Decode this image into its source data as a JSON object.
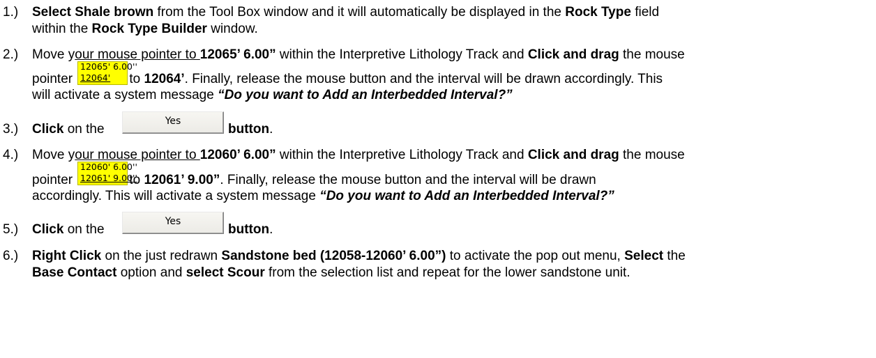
{
  "steps": [
    {
      "num": "1.)",
      "l1": {
        "a": "Select Shale brown",
        "b": " from the Tool Box window and it will automatically be displayed in the ",
        "c": "Rock Type",
        "d": " field"
      },
      "l2": {
        "a": "within the ",
        "b": "Rock Type Builder",
        "c": " window."
      }
    },
    {
      "num": "2.)",
      "l1": {
        "a": "Move y",
        "b": "our mouse pointer to ",
        "c": "12065’ 6.00”",
        "d": " within the Interpretive Lithology Track and ",
        "e": "Click and drag",
        "f": " the mouse"
      },
      "box": {
        "top": "12065' 6.00''",
        "bottom": "12064'"
      },
      "l2": {
        "a": "pointer",
        "b": " to ",
        "c": "12064’",
        "d": ". Finally, release the mouse button and the interval will be drawn accordingly. This"
      },
      "l3": {
        "a": "will activate a system message ",
        "b": "“Do you want to Add an Interbedded Interval?”"
      }
    },
    {
      "num": "3.)",
      "a": "Click",
      "b": " on the ",
      "c": "button",
      "d": ".",
      "button": "Yes"
    },
    {
      "num": "4.)",
      "l1": {
        "a": "Move y",
        "b": "our mouse pointer to ",
        "c": "12060’ 6.00”",
        "d": " within the Interpretive Lithology Track and ",
        "e": "Click and drag",
        "f": " the mouse"
      },
      "box": {
        "top": "12060' 6.00''",
        "bottom": "12061' 9.00''"
      },
      "l2": {
        "a": "pointer",
        "b": " to ",
        "c": "12061’ 9.00”",
        "d": ". Finally, release the mouse button and the interval will be drawn"
      },
      "l3": {
        "a": "accordingly. This will activate a system message ",
        "b": "“Do you want to Add an Interbedded Interval?”"
      }
    },
    {
      "num": "5.)",
      "a": "Click",
      "b": " on the ",
      "c": "button",
      "d": ".",
      "button": "Yes"
    },
    {
      "num": "6.)",
      "l1": {
        "a": "Right Click",
        "b": " on the just redrawn ",
        "c": "Sandstone bed (12058-12060’ 6.00”)",
        "d": " to activate the pop out menu, ",
        "e": "Select",
        "f": " the"
      },
      "l2": {
        "a": "Base Contact",
        "b": " option and ",
        "c": "select Scour",
        "d": " from the selection list and repeat for the lower sandstone unit."
      }
    }
  ]
}
